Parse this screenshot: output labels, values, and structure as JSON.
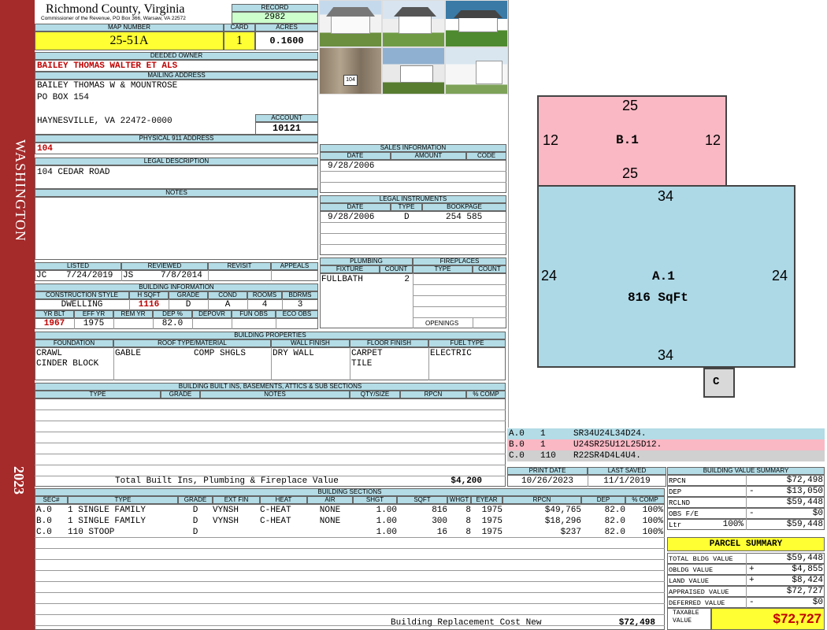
{
  "sidebar": {
    "location": "WASHINGTON",
    "year": "2023"
  },
  "header": {
    "county": "Richmond County, Virginia",
    "commissioner": "Commissioner of the Revenue, PO Box 366, Warsaw, VA 22572"
  },
  "record": {
    "label": "RECORD",
    "value": "2982"
  },
  "map": {
    "label": "MAP NUMBER",
    "value": "25-51A"
  },
  "card": {
    "label": "CARD",
    "value": "1"
  },
  "acres": {
    "label": "ACRES",
    "value": "0.1600"
  },
  "owner": {
    "label": "DEEDED OWNER",
    "value": "BAILEY THOMAS WALTER ET ALS"
  },
  "mailing": {
    "label": "MAILING ADDRESS",
    "line1": "BAILEY THOMAS W & MOUNTROSE",
    "line2": "PO BOX 154",
    "line3": "HAYNESVILLE, VA 22472-0000"
  },
  "account": {
    "label": "ACCOUNT",
    "value": "10121"
  },
  "physical": {
    "label": "PHYSICAL 911 ADDRESS",
    "value": "104"
  },
  "legal": {
    "label": "LEGAL DESCRIPTION",
    "value": "104 CEDAR ROAD"
  },
  "notes": {
    "label": "NOTES"
  },
  "listed": {
    "label": "LISTED",
    "by": "JC",
    "date": "7/24/2019"
  },
  "reviewed": {
    "label": "REVIEWED",
    "by": "JS",
    "date": "7/8/2014"
  },
  "revisit": {
    "label": "REVISIT"
  },
  "appeals": {
    "label": "APPEALS"
  },
  "building_info": {
    "label": "BUILDING INFORMATION",
    "construction_style_label": "CONSTRUCTION STYLE",
    "construction_style": "DWELLING",
    "hsqft_label": "H SQFT",
    "hsqft": "1116",
    "grade_label": "GRADE",
    "grade": "D",
    "cond_label": "COND",
    "cond": "A",
    "rooms_label": "ROOMS",
    "rooms": "4",
    "bdrms_label": "BDRMS",
    "bdrms": "3",
    "yrblt_label": "YR BLT",
    "yrblt": "1967",
    "effyr_label": "EFF YR",
    "effyr": "1975",
    "remyr_label": "REM YR",
    "dep_label": "DEP %",
    "dep": "82.0",
    "depovr_label": "DEPOVR",
    "funobs_label": "FUN OBS",
    "ecoobs_label": "ECO OBS"
  },
  "sales": {
    "label": "SALES INFORMATION",
    "date_label": "DATE",
    "amount_label": "AMOUNT",
    "code_label": "CODE",
    "date": "9/28/2006"
  },
  "instruments": {
    "label": "LEGAL INSTRUMENTS",
    "date_label": "DATE",
    "type_label": "TYPE",
    "book_label": "BOOKPAGE",
    "date": "9/28/2006",
    "type": "D",
    "book": "254 585"
  },
  "plumbing": {
    "label": "PLUMBING",
    "fixture_label": "FIXTURE",
    "count_label": "COUNT",
    "fixture": "FULLBATH",
    "count": "2"
  },
  "fireplaces": {
    "label": "FIREPLACES",
    "type_label": "TYPE",
    "count_label": "COUNT",
    "openings_label": "OPENINGS"
  },
  "properties": {
    "label": "BUILDING PROPERTIES",
    "foundation_label": "FOUNDATION",
    "foundation1": "CRAWL",
    "foundation2": "CINDER BLOCK",
    "roof_label": "ROOF TYPE/MATERIAL",
    "roof_type": "GABLE",
    "roof_mat": "COMP SHGLS",
    "wall_label": "WALL FINISH",
    "wall": "DRY WALL",
    "floor_label": "FLOOR FINISH",
    "floor1": "CARPET",
    "floor2": "TILE",
    "fuel_label": "FUEL TYPE",
    "fuel": "ELECTRIC"
  },
  "builtins": {
    "label": "BUILDING BUILT INS, BASEMENTS, ATTICS & SUB SECTIONS",
    "type_label": "TYPE",
    "grade_label": "GRADE",
    "notes_label": "NOTES",
    "qty_label": "QTY/SIZE",
    "rpcn_label": "RPCN",
    "pct_label": "% COMP",
    "total_label": "Total Built Ins, Plumbing & Fireplace Value",
    "total_value": "$4,200"
  },
  "print": {
    "print_label": "PRINT DATE",
    "print_date": "10/26/2023",
    "saved_label": "LAST SAVED",
    "saved_date": "11/1/2019"
  },
  "sections": {
    "label": "BUILDING SECTIONS",
    "headers": [
      "SEC#",
      "TYPE",
      "GRADE",
      "EXT FIN",
      "HEAT",
      "AIR",
      "SHGT",
      "SQFT",
      "WHGT",
      "EYEAR",
      "RPCN",
      "DEP",
      "% COMP"
    ],
    "rows": [
      {
        "sec": "A.0",
        "type": "1 SINGLE FAMILY",
        "grade": "D",
        "extfin": "VYNSH",
        "heat": "C-HEAT",
        "air": "NONE",
        "shgt": "1.00",
        "sqft": "816",
        "whgt": "8",
        "eyear": "1975",
        "rpcn": "$49,765",
        "dep": "82.0",
        "comp": "100%"
      },
      {
        "sec": "B.0",
        "type": "1 SINGLE FAMILY",
        "grade": "D",
        "extfin": "VYNSH",
        "heat": "C-HEAT",
        "air": "NONE",
        "shgt": "1.00",
        "sqft": "300",
        "whgt": "8",
        "eyear": "1975",
        "rpcn": "$18,296",
        "dep": "82.0",
        "comp": "100%"
      },
      {
        "sec": "C.0",
        "type": "110 STOOP",
        "grade": "D",
        "extfin": "",
        "heat": "",
        "air": "",
        "shgt": "1.00",
        "sqft": "16",
        "whgt": "8",
        "eyear": "1975",
        "rpcn": "$237",
        "dep": "82.0",
        "comp": "100%"
      }
    ],
    "replacement_label": "Building Replacement Cost New",
    "replacement_value": "$72,498"
  },
  "sketch": {
    "b_label": "B.1",
    "b_top": "25",
    "b_bottom": "25",
    "b_left": "12",
    "b_right": "12",
    "a_label": "A.1",
    "a_area": "816 SqFt",
    "a_top": "34",
    "a_bottom": "34",
    "a_left": "24",
    "a_right": "24",
    "c_label": "C"
  },
  "sketch_codes": [
    {
      "sec": "A.0",
      "num": "1",
      "code": "SR34U24L34D24.",
      "color": "#b3dce6"
    },
    {
      "sec": "B.0",
      "num": "1",
      "code": "U24SR25U12L25D12.",
      "color": "#f9b8c4"
    },
    {
      "sec": "C.0",
      "num": "110",
      "code": "R22SR4D4L4U4.",
      "color": "#d0d0d0"
    }
  ],
  "value_summary": {
    "label": "BUILDING VALUE SUMMARY",
    "rows": [
      {
        "label": "RPCN",
        "sign": "",
        "value": "$72,498"
      },
      {
        "label": "DEP",
        "sign": "-",
        "value": "$13,050"
      },
      {
        "label": "RCLND",
        "sign": "",
        "value": "$59,448"
      },
      {
        "label": "OBS F/E",
        "sign": "-",
        "value": "$0"
      },
      {
        "label": "Ltr",
        "pct": "100%",
        "sign": "",
        "value": "$59,448"
      }
    ]
  },
  "parcel": {
    "label": "PARCEL SUMMARY",
    "rows": [
      {
        "label": "TOTAL BLDG VALUE",
        "sign": "",
        "value": "$59,448"
      },
      {
        "label": "OBLDG VALUE",
        "sign": "+",
        "value": "$4,855"
      },
      {
        "label": "LAND VALUE",
        "sign": "+",
        "value": "$8,424"
      },
      {
        "label": "APPRAISED VALUE",
        "sign": "",
        "value": "$72,727"
      },
      {
        "label": "DEFERRED VALUE",
        "sign": "-",
        "value": "$0"
      }
    ],
    "taxable_label": "TAXABLE VALUE",
    "taxable_value": "$72,727"
  },
  "colors": {
    "sidebar": "#a52a2a",
    "header_blue": "#b3dce6",
    "highlight": "#ffff33",
    "record_green": "#ccffcc",
    "value_red": "#c00000",
    "sketch_a": "#add8e6",
    "sketch_b": "#f9b8c4"
  }
}
